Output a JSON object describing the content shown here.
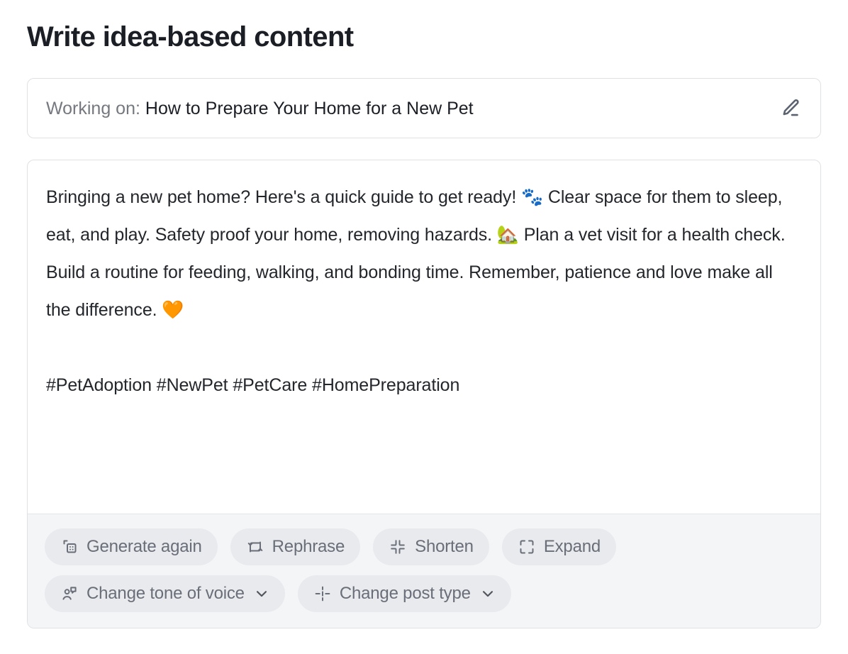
{
  "page": {
    "title": "Write idea-based content"
  },
  "working_on": {
    "label": "Working on:",
    "topic": "How to Prepare Your Home for a New Pet",
    "edit_icon": "pencil-edit-icon"
  },
  "editor": {
    "paragraphs": [
      "Bringing a new pet home? Here's a quick guide to get ready! 🐾 Clear space for them to sleep, eat, and play. Safety proof your home, removing hazards. 🏡 Plan a vet visit for a health check. Build a routine for feeding, walking, and bonding time. Remember, patience and love make all the difference. 🧡",
      "#PetAdoption #NewPet #PetCare #HomePreparation"
    ]
  },
  "toolbar": {
    "rows": [
      [
        {
          "label": "Generate again",
          "icon": "duplicate-grid-icon",
          "chevron": false
        },
        {
          "label": "Rephrase",
          "icon": "swap-arrows-icon",
          "chevron": false
        },
        {
          "label": "Shorten",
          "icon": "collapse-arrows-icon",
          "chevron": false
        },
        {
          "label": "Expand",
          "icon": "expand-corners-icon",
          "chevron": false
        }
      ],
      [
        {
          "label": "Change tone of voice",
          "icon": "person-speech-icon",
          "chevron": true
        },
        {
          "label": "Change post type",
          "icon": "crosshair-dashes-icon",
          "chevron": true
        }
      ]
    ]
  },
  "colors": {
    "page_background": "#ffffff",
    "title_text": "#1b1f25",
    "body_text": "#23262b",
    "muted_text": "#75797f",
    "card_border": "#dfe1e5",
    "toolbar_background": "#f4f5f7",
    "pill_background": "#e9eaee",
    "pill_text": "#6a6e78",
    "icon_gray": "#5c6370"
  }
}
